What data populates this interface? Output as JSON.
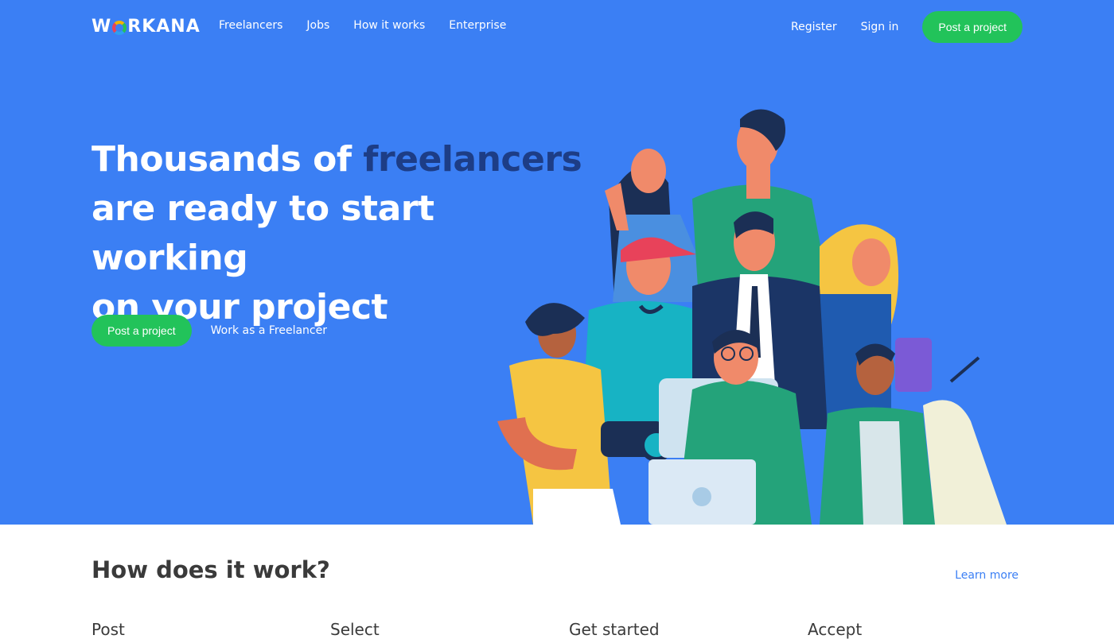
{
  "brand": {
    "logo_part1": "W",
    "logo_part2": "RKANA",
    "accent": "#3b7ff4",
    "green": "#22c35a"
  },
  "nav": {
    "links": [
      "Freelancers",
      "Jobs",
      "How it works",
      "Enterprise"
    ],
    "register": "Register",
    "sign_in": "Sign in",
    "post_project": "Post a project"
  },
  "hero": {
    "headline_1": "Thousands of ",
    "headline_accent": "freelancers",
    "headline_2": "are ready to start working",
    "headline_3": "on your project",
    "cta_primary": "Post a project",
    "cta_secondary": "Work as a Freelancer",
    "illustration": "group-of-freelancers-illustration"
  },
  "how": {
    "title": "How does it work?",
    "learn_more": "Learn more",
    "steps": [
      "Post",
      "Select",
      "Get started",
      "Accept"
    ]
  }
}
